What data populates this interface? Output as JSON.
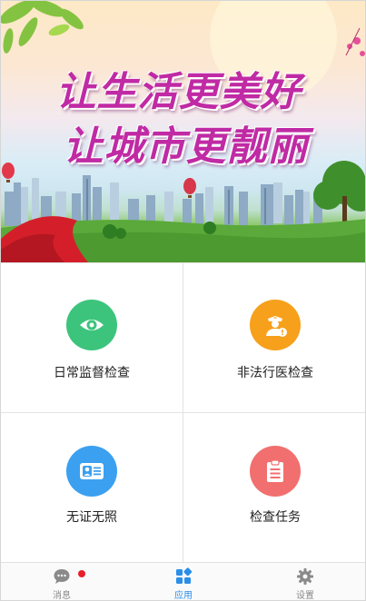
{
  "banner": {
    "line1": "让生活更美好",
    "line2": "让城市更靓丽"
  },
  "apps": [
    {
      "label": "日常监督检查",
      "icon": "eye-icon",
      "color": "#3cc47c"
    },
    {
      "label": "非法行医检查",
      "icon": "doctor-alert-icon",
      "color": "#f7a01c"
    },
    {
      "label": "无证无照",
      "icon": "id-card-icon",
      "color": "#3ba0f0"
    },
    {
      "label": "检查任务",
      "icon": "clipboard-icon",
      "color": "#f26f6f"
    }
  ],
  "tabbar": {
    "items": [
      {
        "label": "消息",
        "icon": "chat-icon",
        "active": false,
        "badge": true
      },
      {
        "label": "应用",
        "icon": "apps-grid-icon",
        "active": true
      },
      {
        "label": "设置",
        "icon": "gear-icon",
        "active": false
      }
    ],
    "accent": "#2b8ee8",
    "badge_color": "#e8202b"
  }
}
